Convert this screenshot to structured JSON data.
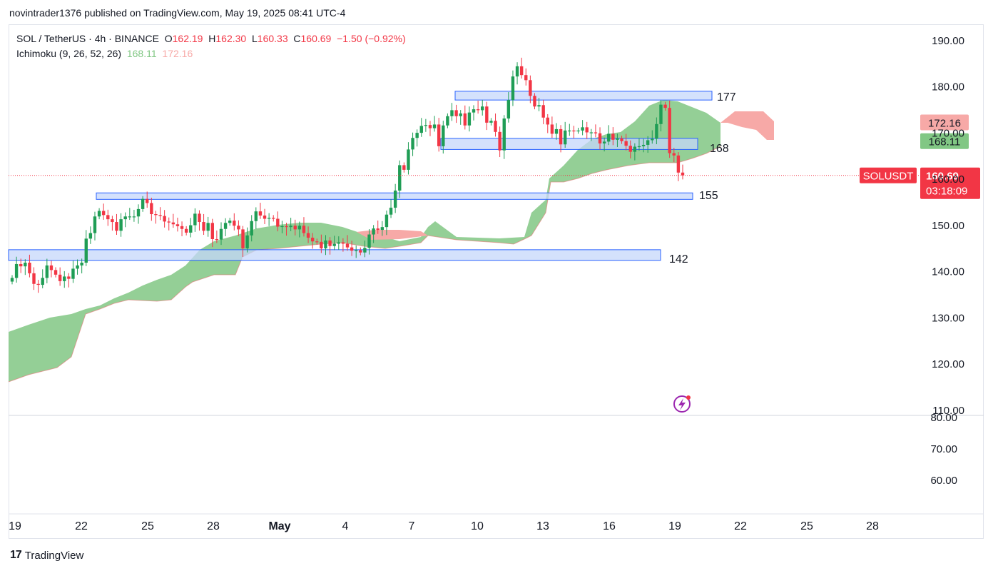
{
  "header": {
    "publisher": "novintrader1376 published on TradingView.com, May 19, 2025 08:41 UTC-4"
  },
  "legend": {
    "symbol": "SOL / TetherUS · 4h · BINANCE",
    "o_label": "O",
    "o_value": "162.19",
    "h_label": "H",
    "h_value": "162.30",
    "l_label": "L",
    "l_value": "160.33",
    "c_label": "C",
    "c_value": "160.69",
    "change": "−1.50 (−0.92%)",
    "indicator": "Ichimoku (9, 26, 52, 26)",
    "indicator_val1": "168.11",
    "indicator_val2": "172.16"
  },
  "footer": {
    "brand": "TradingView"
  },
  "colors": {
    "up": "#26a69a",
    "up_body": "#1f9d55",
    "down": "#f23645",
    "cloud_bull": "#81c784",
    "cloud_bear": "#f7a9a7",
    "zone_fill": "#c5d7fb",
    "zone_stroke": "#2962ff",
    "price_tag": "#f23645"
  },
  "chart_data": {
    "type": "candlestick",
    "symbol": "SOLUSDT",
    "timeframe": "4h",
    "y_axis": {
      "ticks": [
        "190.00",
        "180.00",
        "170.00",
        "160.00",
        "150.00",
        "140.00",
        "130.00",
        "120.00",
        "110.00"
      ],
      "min": 110,
      "max": 190
    },
    "lower_axis": {
      "ticks": [
        "80.00",
        "70.00",
        "60.00"
      ]
    },
    "x_axis": {
      "labels": [
        "19",
        "22",
        "25",
        "28",
        "May",
        "4",
        "7",
        "10",
        "13",
        "16",
        "19",
        "22",
        "25",
        "28"
      ]
    },
    "horizontal_zones": [
      {
        "label": "177",
        "top": 178.9,
        "bottom": 177.0,
        "from_day": 9.6,
        "to_day": 21.3
      },
      {
        "label": "168",
        "top": 168.7,
        "bottom": 166.3,
        "from_day": 9.3,
        "to_day": 21.0
      },
      {
        "label": "155",
        "top": 156.9,
        "bottom": 155.5,
        "from_day": 22.7,
        "to_day": 21.8
      },
      {
        "label": "142",
        "top": 144.6,
        "bottom": 142.3,
        "from_day": 19.0,
        "to_day": 20.5
      }
    ],
    "current_price": {
      "symbol_tag": "SOLUSDT",
      "price": "160.69",
      "countdown": "03:18:09",
      "value": 160.69
    },
    "ichimoku_tags": [
      {
        "value": 172.16,
        "label": "172.16",
        "color": "#f7a9a7"
      },
      {
        "value": 168.11,
        "label": "168.11",
        "color": "#81c784"
      }
    ],
    "closes": [
      138.5,
      141.5,
      141.0,
      141.8,
      139.5,
      137.2,
      137.0,
      138.5,
      141.2,
      140.2,
      139.2,
      137.8,
      138.8,
      138.3,
      140.5,
      141.2,
      141.8,
      147.0,
      148.2,
      151.8,
      153.0,
      152.1,
      151.2,
      150.6,
      148.7,
      151.2,
      151.8,
      151.8,
      151.8,
      153.4,
      155.6,
      154.7,
      152.3,
      152.1,
      151.9,
      150.7,
      150.5,
      150.1,
      149.7,
      149.1,
      148.3,
      149.9,
      152.4,
      150.6,
      148.7,
      150.4,
      146.9,
      146.8,
      149.1,
      150.4,
      150.9,
      149.8,
      149.0,
      144.9,
      147.7,
      150.8,
      152.9,
      152.0,
      151.3,
      151.5,
      151.3,
      149.6,
      149.7,
      149.5,
      149.8,
      149.0,
      149.8,
      148.2,
      147.2,
      146.4,
      146.3,
      144.9,
      146.6,
      145.4,
      145.9,
      146.2,
      145.9,
      145.1,
      144.4,
      144.5,
      144.0,
      145.0,
      147.9,
      149.2,
      148.9,
      149.5,
      152.2,
      153.7,
      157.4,
      162.9,
      161.9,
      166.3,
      168.8,
      169.9,
      171.4,
      171.6,
      170.9,
      171.7,
      167.0,
      171.5,
      173.5,
      174.8,
      173.5,
      174.1,
      171.5,
      174.3,
      175.0,
      174.8,
      175.6,
      172.1,
      172.5,
      170.1,
      166.1,
      173.0,
      177.0,
      182.1,
      184.3,
      182.4,
      181.3,
      177.9,
      175.6,
      175.9,
      173.2,
      171.7,
      169.7,
      170.7,
      167.4,
      170.4,
      170.4,
      170.3,
      170.4,
      171.1,
      170.0,
      170.0,
      169.8,
      167.6,
      168.0,
      169.7,
      168.4,
      168.7,
      168.1,
      167.1,
      165.8,
      166.9,
      167.0,
      167.3,
      168.3,
      168.6,
      171.8,
      176.0,
      175.3,
      165.5,
      165.0,
      161.3,
      160.7
    ]
  }
}
